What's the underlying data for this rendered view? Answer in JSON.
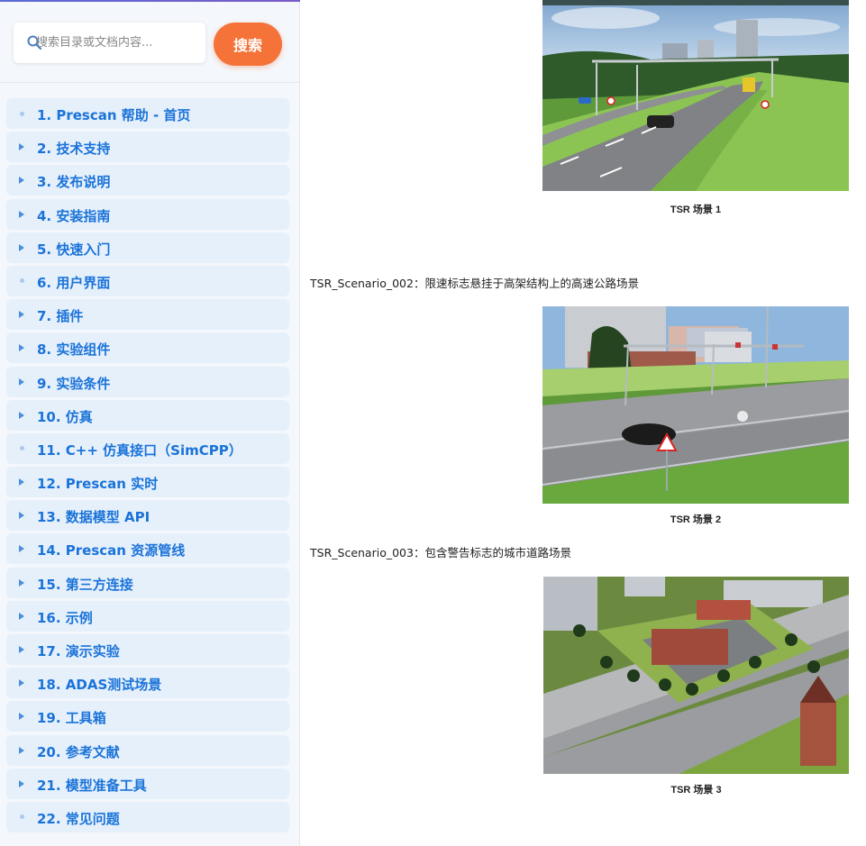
{
  "search": {
    "placeholder": "搜索目录或文档内容...",
    "button_label": "搜索"
  },
  "sidebar": {
    "items": [
      {
        "label": "1. Prescan 帮助 - 首页",
        "marker": "dot"
      },
      {
        "label": "2. 技术支持",
        "marker": "triangle"
      },
      {
        "label": "3. 发布说明",
        "marker": "triangle"
      },
      {
        "label": "4. 安装指南",
        "marker": "triangle"
      },
      {
        "label": "5. 快速入门",
        "marker": "triangle"
      },
      {
        "label": "6. 用户界面",
        "marker": "dot"
      },
      {
        "label": "7. 插件",
        "marker": "triangle"
      },
      {
        "label": "8. 实验组件",
        "marker": "triangle"
      },
      {
        "label": "9. 实验条件",
        "marker": "triangle"
      },
      {
        "label": "10. 仿真",
        "marker": "triangle"
      },
      {
        "label": "11. C++ 仿真接口（SimCPP）",
        "marker": "dot"
      },
      {
        "label": "12. Prescan 实时",
        "marker": "triangle"
      },
      {
        "label": "13. 数据模型 API",
        "marker": "triangle"
      },
      {
        "label": "14. Prescan 资源管线",
        "marker": "triangle"
      },
      {
        "label": "15. 第三方连接",
        "marker": "triangle"
      },
      {
        "label": "16. 示例",
        "marker": "triangle"
      },
      {
        "label": "17. 演示实验",
        "marker": "triangle"
      },
      {
        "label": "18. ADAS测试场景",
        "marker": "triangle"
      },
      {
        "label": "19. 工具箱",
        "marker": "triangle"
      },
      {
        "label": "20. 参考文献",
        "marker": "triangle"
      },
      {
        "label": "21. 模型准备工具",
        "marker": "triangle"
      },
      {
        "label": "22. 常见问题",
        "marker": "dot"
      }
    ]
  },
  "content": {
    "captions": [
      "TSR 场景 1",
      "TSR 场景 2",
      "TSR 场景 3"
    ],
    "scenario_002": "TSR_Scenario_002：限速标志悬挂于高架结构上的高速公路场景",
    "scenario_003": "TSR_Scenario_003：包含警告标志的城市道路场景"
  },
  "colors": {
    "accent": "#f57338",
    "link": "#1a73d9",
    "nav_bg": "#e6f0fb",
    "sidebar_bg": "#f4f7fb"
  }
}
